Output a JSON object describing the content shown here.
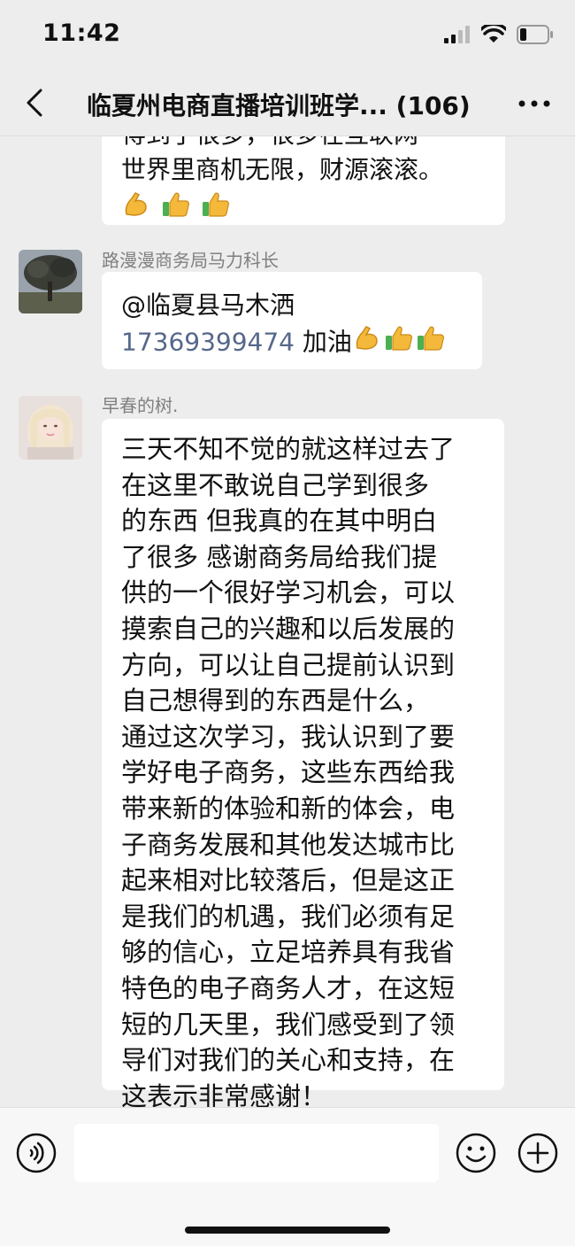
{
  "status": {
    "time": "11:42"
  },
  "header": {
    "title": "临夏州电商直播培训班学... (106)"
  },
  "messages": [
    {
      "id": "partial",
      "lines": [
        "得到了很多，很多在互联网",
        "世界里商机无限，财源滚滚。"
      ],
      "emojis": [
        "flexed-biceps",
        "thumbs-up",
        "thumbs-up"
      ]
    },
    {
      "id": "msg1",
      "sender": "路漫漫商务局马力科长",
      "mention": "@临夏县马木洒",
      "phone": "17369399474",
      "text": " 加油",
      "emojis": [
        "flexed-biceps",
        "thumbs-up",
        "thumbs-up"
      ]
    },
    {
      "id": "msg2",
      "sender": "早春的树.",
      "lines": [
        "三天不知不觉的就这样过去了",
        " 在这里不敢说自己学到很多",
        "的东西 但我真的在其中明白",
        "了很多 感谢商务局给我们提",
        "供的一个很好学习机会，可以",
        "摸索自己的兴趣和以后发展的",
        "方向，可以让自己提前认识到",
        "自己想得到的东西是什么，",
        "通过这次学习，我认识到了要",
        "学好电子商务，这些东西给我",
        "带来新的体验和新的体会，电",
        "子商务发展和其他发达城市比",
        "起来相对比较落后，但是这正",
        "是我们的机遇，我们必须有足",
        "够的信心，立足培养具有我省",
        "特色的电子商务人才，在这短",
        "短的几天里，我们感受到了领",
        "导们对我们的关心和支持，在",
        "这表示非常感谢！"
      ]
    }
  ],
  "input": {
    "placeholder": ""
  },
  "icons": {
    "back": "chevron-left-icon",
    "more": "more-dots-icon",
    "voice": "voice-icon",
    "emoji": "emoji-smile-icon",
    "plus": "plus-circle-icon"
  },
  "colors": {
    "background": "#ededed",
    "bubble": "#ffffff",
    "name": "#808080",
    "phone_link": "#56678b"
  }
}
